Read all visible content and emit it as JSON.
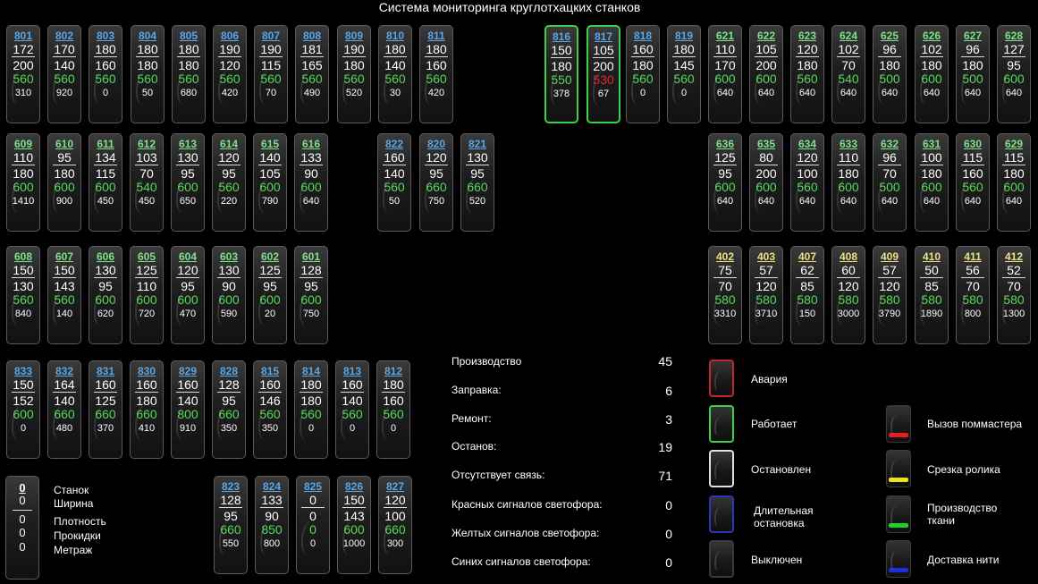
{
  "title": "Система мониторинга круглотхацких станков",
  "id_colors": {
    "blue": "#5aa6e6",
    "green": "#7fe08a",
    "yellow": "#f0e080"
  },
  "machines": [
    {
      "id": "801",
      "c": "blue",
      "v": [
        "172",
        "200",
        "560",
        "310"
      ]
    },
    {
      "id": "802",
      "c": "blue",
      "v": [
        "170",
        "140",
        "560",
        "920"
      ]
    },
    {
      "id": "803",
      "c": "blue",
      "v": [
        "180",
        "160",
        "560",
        "0"
      ]
    },
    {
      "id": "804",
      "c": "blue",
      "v": [
        "180",
        "180",
        "560",
        "50"
      ]
    },
    {
      "id": "805",
      "c": "blue",
      "v": [
        "180",
        "180",
        "560",
        "680"
      ]
    },
    {
      "id": "806",
      "c": "blue",
      "v": [
        "190",
        "120",
        "560",
        "420"
      ]
    },
    {
      "id": "807",
      "c": "blue",
      "v": [
        "190",
        "115",
        "560",
        "70"
      ]
    },
    {
      "id": "808",
      "c": "blue",
      "v": [
        "181",
        "165",
        "560",
        "490"
      ]
    },
    {
      "id": "809",
      "c": "blue",
      "v": [
        "190",
        "180",
        "560",
        "520"
      ]
    },
    {
      "id": "810",
      "c": "blue",
      "v": [
        "180",
        "140",
        "560",
        "30"
      ]
    },
    {
      "id": "811",
      "c": "blue",
      "v": [
        "180",
        "160",
        "560",
        "420"
      ]
    },
    {
      "id": "816",
      "c": "blue",
      "v": [
        "150",
        "180",
        "550",
        "378"
      ],
      "status": "green"
    },
    {
      "id": "817",
      "c": "blue",
      "v": [
        "105",
        "200",
        "530",
        "67"
      ],
      "status": "green",
      "alert": true
    },
    {
      "id": "818",
      "c": "blue",
      "v": [
        "160",
        "180",
        "560",
        "0"
      ]
    },
    {
      "id": "819",
      "c": "blue",
      "v": [
        "180",
        "145",
        "560",
        "0"
      ]
    },
    {
      "id": "621",
      "c": "green",
      "v": [
        "110",
        "170",
        "600",
        "640"
      ]
    },
    {
      "id": "622",
      "c": "green",
      "v": [
        "105",
        "200",
        "600",
        "640"
      ]
    },
    {
      "id": "623",
      "c": "green",
      "v": [
        "120",
        "180",
        "560",
        "640"
      ]
    },
    {
      "id": "624",
      "c": "green",
      "v": [
        "102",
        "70",
        "540",
        "640"
      ]
    },
    {
      "id": "625",
      "c": "green",
      "v": [
        "96",
        "180",
        "500",
        "640"
      ]
    },
    {
      "id": "626",
      "c": "green",
      "v": [
        "102",
        "180",
        "600",
        "640"
      ]
    },
    {
      "id": "627",
      "c": "green",
      "v": [
        "96",
        "180",
        "500",
        "640"
      ]
    },
    {
      "id": "628",
      "c": "green",
      "v": [
        "127",
        "95",
        "600",
        "640"
      ]
    },
    {
      "id": "609",
      "c": "green",
      "v": [
        "110",
        "180",
        "600",
        "1410"
      ]
    },
    {
      "id": "610",
      "c": "green",
      "v": [
        "95",
        "180",
        "600",
        "900"
      ]
    },
    {
      "id": "611",
      "c": "green",
      "v": [
        "134",
        "115",
        "600",
        "450"
      ]
    },
    {
      "id": "612",
      "c": "green",
      "v": [
        "103",
        "70",
        "540",
        "450"
      ]
    },
    {
      "id": "613",
      "c": "green",
      "v": [
        "130",
        "95",
        "600",
        "650"
      ]
    },
    {
      "id": "614",
      "c": "green",
      "v": [
        "120",
        "95",
        "560",
        "220"
      ]
    },
    {
      "id": "615",
      "c": "green",
      "v": [
        "140",
        "105",
        "600",
        "790"
      ]
    },
    {
      "id": "616",
      "c": "green",
      "v": [
        "133",
        "90",
        "600",
        "640"
      ]
    },
    {
      "id": "822",
      "c": "blue",
      "v": [
        "160",
        "140",
        "560",
        "50"
      ]
    },
    {
      "id": "820",
      "c": "blue",
      "v": [
        "120",
        "95",
        "660",
        "750"
      ]
    },
    {
      "id": "821",
      "c": "blue",
      "v": [
        "130",
        "95",
        "660",
        "520"
      ]
    },
    {
      "id": "636",
      "c": "green",
      "v": [
        "125",
        "95",
        "600",
        "640"
      ]
    },
    {
      "id": "635",
      "c": "green",
      "v": [
        "80",
        "200",
        "600",
        "640"
      ]
    },
    {
      "id": "634",
      "c": "green",
      "v": [
        "120",
        "100",
        "560",
        "640"
      ]
    },
    {
      "id": "633",
      "c": "green",
      "v": [
        "110",
        "180",
        "600",
        "640"
      ]
    },
    {
      "id": "632",
      "c": "green",
      "v": [
        "96",
        "70",
        "500",
        "640"
      ]
    },
    {
      "id": "631",
      "c": "green",
      "v": [
        "100",
        "180",
        "600",
        "640"
      ]
    },
    {
      "id": "630",
      "c": "green",
      "v": [
        "115",
        "160",
        "560",
        "640"
      ]
    },
    {
      "id": "629",
      "c": "green",
      "v": [
        "115",
        "180",
        "600",
        "640"
      ]
    },
    {
      "id": "608",
      "c": "green",
      "v": [
        "150",
        "130",
        "560",
        "840"
      ]
    },
    {
      "id": "607",
      "c": "green",
      "v": [
        "150",
        "143",
        "560",
        "140"
      ]
    },
    {
      "id": "606",
      "c": "green",
      "v": [
        "130",
        "95",
        "600",
        "620"
      ]
    },
    {
      "id": "605",
      "c": "green",
      "v": [
        "125",
        "110",
        "600",
        "720"
      ]
    },
    {
      "id": "604",
      "c": "green",
      "v": [
        "120",
        "95",
        "600",
        "470"
      ]
    },
    {
      "id": "603",
      "c": "green",
      "v": [
        "130",
        "90",
        "600",
        "590"
      ]
    },
    {
      "id": "602",
      "c": "green",
      "v": [
        "125",
        "95",
        "600",
        "20"
      ]
    },
    {
      "id": "601",
      "c": "green",
      "v": [
        "128",
        "95",
        "600",
        "750"
      ]
    },
    {
      "id": "402",
      "c": "yellow",
      "v": [
        "75",
        "70",
        "580",
        "3310"
      ]
    },
    {
      "id": "403",
      "c": "yellow",
      "v": [
        "57",
        "120",
        "580",
        "3710"
      ]
    },
    {
      "id": "407",
      "c": "yellow",
      "v": [
        "62",
        "85",
        "580",
        "150"
      ]
    },
    {
      "id": "408",
      "c": "yellow",
      "v": [
        "60",
        "120",
        "580",
        "3000"
      ]
    },
    {
      "id": "409",
      "c": "yellow",
      "v": [
        "57",
        "120",
        "580",
        "3790"
      ]
    },
    {
      "id": "410",
      "c": "yellow",
      "v": [
        "50",
        "85",
        "580",
        "1890"
      ]
    },
    {
      "id": "411",
      "c": "yellow",
      "v": [
        "56",
        "70",
        "580",
        "800"
      ]
    },
    {
      "id": "412",
      "c": "yellow",
      "v": [
        "52",
        "70",
        "580",
        "1300"
      ]
    },
    {
      "id": "833",
      "c": "blue",
      "v": [
        "150",
        "152",
        "600",
        "0"
      ]
    },
    {
      "id": "832",
      "c": "blue",
      "v": [
        "164",
        "140",
        "660",
        "480"
      ]
    },
    {
      "id": "831",
      "c": "blue",
      "v": [
        "160",
        "125",
        "660",
        "370"
      ]
    },
    {
      "id": "830",
      "c": "blue",
      "v": [
        "160",
        "180",
        "660",
        "410"
      ]
    },
    {
      "id": "829",
      "c": "blue",
      "v": [
        "160",
        "140",
        "800",
        "910"
      ]
    },
    {
      "id": "828",
      "c": "blue",
      "v": [
        "128",
        "95",
        "660",
        "350"
      ]
    },
    {
      "id": "815",
      "c": "blue",
      "v": [
        "160",
        "146",
        "560",
        "350"
      ]
    },
    {
      "id": "814",
      "c": "blue",
      "v": [
        "180",
        "180",
        "560",
        "0"
      ]
    },
    {
      "id": "813",
      "c": "blue",
      "v": [
        "160",
        "140",
        "560",
        "0"
      ]
    },
    {
      "id": "812",
      "c": "blue",
      "v": [
        "180",
        "160",
        "560",
        "0"
      ]
    },
    {
      "id": "823",
      "c": "blue",
      "v": [
        "128",
        "95",
        "660",
        "550"
      ]
    },
    {
      "id": "824",
      "c": "blue",
      "v": [
        "133",
        "90",
        "850",
        "800"
      ]
    },
    {
      "id": "825",
      "c": "blue",
      "v": [
        "0",
        "0",
        "0",
        "0"
      ]
    },
    {
      "id": "826",
      "c": "blue",
      "v": [
        "150",
        "143",
        "600",
        "1000"
      ]
    },
    {
      "id": "827",
      "c": "blue",
      "v": [
        "120",
        "100",
        "660",
        "300"
      ]
    }
  ],
  "legend": {
    "values": [
      "0",
      "0",
      "0",
      "0",
      "0"
    ],
    "labels": [
      "Станок",
      "Ширина",
      "Плотность",
      "Прокидки",
      "Метраж"
    ]
  },
  "stats": [
    {
      "label": "Производство",
      "value": "45"
    },
    {
      "label": "Заправка:",
      "value": "6"
    },
    {
      "label": "Ремонт:",
      "value": "3"
    },
    {
      "label": "Останов:",
      "value": "19"
    },
    {
      "label": "Отсутствует связь:",
      "value": "71"
    },
    {
      "label": "Красных сигналов светофора:",
      "value": "0"
    },
    {
      "label": "Желтых сигналов светофора:",
      "value": "0"
    },
    {
      "label": "Синих сигналов светофора:",
      "value": "0"
    }
  ],
  "status_legend": [
    {
      "label": "Авария",
      "border": "#c0282b"
    },
    {
      "label": "Работает",
      "border": "#3fd04b"
    },
    {
      "label": "Остановлен",
      "border": "#e0e0e0"
    },
    {
      "label": "Длительная остановка",
      "border": "#2a36b8"
    },
    {
      "label": "Выключен",
      "border": "#3a3a3a"
    }
  ],
  "signal_legend": [
    {
      "label": "Вызов поммастера",
      "bar": "#e81c1c"
    },
    {
      "label": "Срезка ролика",
      "bar": "#f0e21a"
    },
    {
      "label": "Производство ткани",
      "bar": "#1fd02a"
    },
    {
      "label": "Доставка нити",
      "bar": "#1c2fd8"
    }
  ]
}
